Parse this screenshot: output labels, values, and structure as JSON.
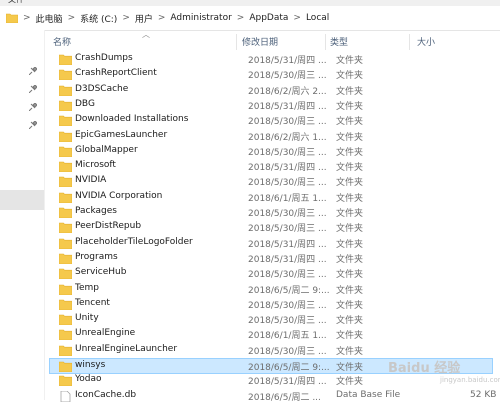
{
  "window": {
    "top_strip_text": "文件"
  },
  "address": {
    "crumbs": [
      "此电脑",
      "系统 (C:)",
      "用户",
      "Administrator",
      "AppData",
      "Local"
    ],
    "separator": ">"
  },
  "columns": {
    "name": "名称",
    "date": "修改日期",
    "type": "类型",
    "size": "大小"
  },
  "files": [
    {
      "name": "CrashDumps",
      "date": "2018/5/31/周四 ...",
      "type": "文件夹",
      "size": ""
    },
    {
      "name": "CrashReportClient",
      "date": "2018/5/30/周三 ...",
      "type": "文件夹",
      "size": ""
    },
    {
      "name": "D3DSCache",
      "date": "2018/6/2/周六 2...",
      "type": "文件夹",
      "size": ""
    },
    {
      "name": "DBG",
      "date": "2018/5/31/周四 ...",
      "type": "文件夹",
      "size": ""
    },
    {
      "name": "Downloaded Installations",
      "date": "2018/5/30/周三 ...",
      "type": "文件夹",
      "size": ""
    },
    {
      "name": "EpicGamesLauncher",
      "date": "2018/6/2/周六 1...",
      "type": "文件夹",
      "size": ""
    },
    {
      "name": "GlobalMapper",
      "date": "2018/5/30/周三 ...",
      "type": "文件夹",
      "size": ""
    },
    {
      "name": "Microsoft",
      "date": "2018/5/31/周四 ...",
      "type": "文件夹",
      "size": ""
    },
    {
      "name": "NVIDIA",
      "date": "2018/5/30/周三 ...",
      "type": "文件夹",
      "size": ""
    },
    {
      "name": "NVIDIA Corporation",
      "date": "2018/6/1/周五 1...",
      "type": "文件夹",
      "size": ""
    },
    {
      "name": "Packages",
      "date": "2018/5/30/周三 ...",
      "type": "文件夹",
      "size": ""
    },
    {
      "name": "PeerDistRepub",
      "date": "2018/5/30/周三 ...",
      "type": "文件夹",
      "size": ""
    },
    {
      "name": "PlaceholderTileLogoFolder",
      "date": "2018/5/31/周四 ...",
      "type": "文件夹",
      "size": ""
    },
    {
      "name": "Programs",
      "date": "2018/5/31/周四 ...",
      "type": "文件夹",
      "size": ""
    },
    {
      "name": "ServiceHub",
      "date": "2018/5/30/周三 ...",
      "type": "文件夹",
      "size": ""
    },
    {
      "name": "Temp",
      "date": "2018/6/5/周二 9:...",
      "type": "文件夹",
      "size": ""
    },
    {
      "name": "Tencent",
      "date": "2018/5/30/周三 ...",
      "type": "文件夹",
      "size": ""
    },
    {
      "name": "Unity",
      "date": "2018/5/30/周三 ...",
      "type": "文件夹",
      "size": ""
    },
    {
      "name": "UnrealEngine",
      "date": "2018/6/1/周五 1...",
      "type": "文件夹",
      "size": ""
    },
    {
      "name": "UnrealEngineLauncher",
      "date": "2018/5/30/周三 ...",
      "type": "文件夹",
      "size": ""
    },
    {
      "name": "winsys",
      "date": "2018/6/5/周二 9:...",
      "type": "文件夹",
      "size": "",
      "selected": true
    },
    {
      "name": "Yodao",
      "date": "2018/5/31/周四 ...",
      "type": "文件夹",
      "size": ""
    },
    {
      "name": "IconCache.db",
      "date": "2018/6/5/周二 ...",
      "type": "Data Base File",
      "size": "52 KB"
    }
  ],
  "watermark": {
    "text": "Baidu 经验",
    "sub": "jingyan.baidu.com"
  },
  "colors": {
    "folder": "#f5c94c",
    "folder_dark": "#e3b02f",
    "selection": "#cce8ff",
    "header_text": "#4c607a"
  },
  "icons": {
    "folder": "folder-icon",
    "pin": "pin-icon",
    "file": "file-icon"
  }
}
